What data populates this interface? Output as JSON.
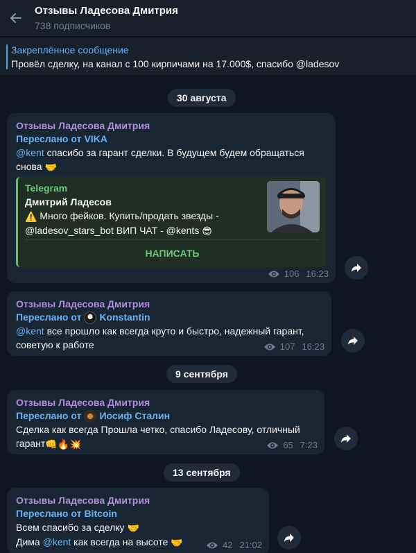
{
  "header": {
    "title": "Отзывы Ладесова Дмитрия",
    "subscribers": "738 подписчиков"
  },
  "pinned": {
    "title": "Закреплённое сообщение",
    "text": "Провёл сделку, на канал с 100 кирпичами на 17.000$, спасибо @ladesov"
  },
  "dates": [
    "30 августа",
    "9 сентября",
    "13 сентября"
  ],
  "messages": [
    {
      "sender": "Отзывы Ладесова Дмитрия",
      "forwarded_prefix": "Переслано от",
      "forwarded_from": "VIKA",
      "mention": "@kent",
      "text_line1": " спасибо за гарант сделки. В будущем будем обращаться",
      "text_line2": "снова",
      "emoji": "🤝",
      "views": "106",
      "time": "16:23",
      "preview": {
        "site": "Telegram",
        "title": "Дмитрий Ладесов",
        "desc_line1": "Много фейков. Купить/продать звезды -",
        "desc_line2": "@ladesov_stars_bot ВИП ЧАТ - @kents",
        "warn_emoji": "⚠️",
        "cool_emoji": "😎",
        "button": "НАПИСАТЬ"
      }
    },
    {
      "sender": "Отзывы Ладесова Дмитрия",
      "forwarded_prefix": "Переслано от",
      "forwarded_from": "Konstantin",
      "mention": "@kent",
      "text_line1": " все прошло как всегда круто и быстро, надежный гарант,",
      "text_line2": "советую к работе",
      "views": "107",
      "time": "16:23"
    },
    {
      "sender": "Отзывы Ладесова Дмитрия",
      "forwarded_prefix": "Переслано от",
      "forwarded_from": "Иосиф Сталин",
      "text_line1": "Сделка как всегда Прошла четко, спасибо Ладесову, отличный",
      "text_line2": "гарант",
      "emojis": "👊🔥💥",
      "views": "65",
      "time": "7:23"
    },
    {
      "sender": "Отзывы Ладесова Дмитрия",
      "forwarded_prefix": "Переслано от",
      "forwarded_from": "Bitcoin",
      "text_line1": "Всем спасибо за сделку",
      "text_line2_prefix": "Дима ",
      "mention": "@kent",
      "text_line2_suffix": " как всегда на высоте",
      "emoji": "🤝",
      "views": "42",
      "time": "21:02"
    }
  ]
}
